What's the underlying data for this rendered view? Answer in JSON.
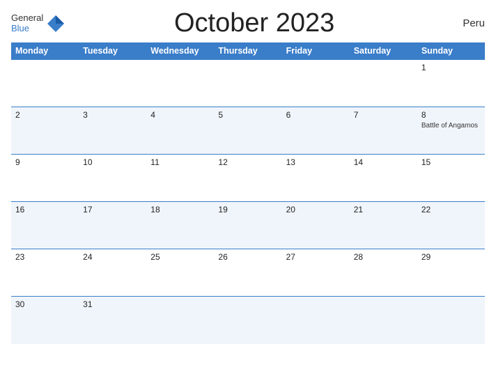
{
  "logo": {
    "general": "General",
    "blue": "Blue"
  },
  "calendar": {
    "title": "October 2023",
    "country": "Peru",
    "weekdays": [
      "Monday",
      "Tuesday",
      "Wednesday",
      "Thursday",
      "Friday",
      "Saturday",
      "Sunday"
    ],
    "weeks": [
      [
        {
          "day": "",
          "event": ""
        },
        {
          "day": "",
          "event": ""
        },
        {
          "day": "",
          "event": ""
        },
        {
          "day": "",
          "event": ""
        },
        {
          "day": "",
          "event": ""
        },
        {
          "day": "",
          "event": ""
        },
        {
          "day": "1",
          "event": ""
        }
      ],
      [
        {
          "day": "2",
          "event": ""
        },
        {
          "day": "3",
          "event": ""
        },
        {
          "day": "4",
          "event": ""
        },
        {
          "day": "5",
          "event": ""
        },
        {
          "day": "6",
          "event": ""
        },
        {
          "day": "7",
          "event": ""
        },
        {
          "day": "8",
          "event": "Battle of Angamos"
        }
      ],
      [
        {
          "day": "9",
          "event": ""
        },
        {
          "day": "10",
          "event": ""
        },
        {
          "day": "11",
          "event": ""
        },
        {
          "day": "12",
          "event": ""
        },
        {
          "day": "13",
          "event": ""
        },
        {
          "day": "14",
          "event": ""
        },
        {
          "day": "15",
          "event": ""
        }
      ],
      [
        {
          "day": "16",
          "event": ""
        },
        {
          "day": "17",
          "event": ""
        },
        {
          "day": "18",
          "event": ""
        },
        {
          "day": "19",
          "event": ""
        },
        {
          "day": "20",
          "event": ""
        },
        {
          "day": "21",
          "event": ""
        },
        {
          "day": "22",
          "event": ""
        }
      ],
      [
        {
          "day": "23",
          "event": ""
        },
        {
          "day": "24",
          "event": ""
        },
        {
          "day": "25",
          "event": ""
        },
        {
          "day": "26",
          "event": ""
        },
        {
          "day": "27",
          "event": ""
        },
        {
          "day": "28",
          "event": ""
        },
        {
          "day": "29",
          "event": ""
        }
      ],
      [
        {
          "day": "30",
          "event": ""
        },
        {
          "day": "31",
          "event": ""
        },
        {
          "day": "",
          "event": ""
        },
        {
          "day": "",
          "event": ""
        },
        {
          "day": "",
          "event": ""
        },
        {
          "day": "",
          "event": ""
        },
        {
          "day": "",
          "event": ""
        }
      ]
    ]
  }
}
